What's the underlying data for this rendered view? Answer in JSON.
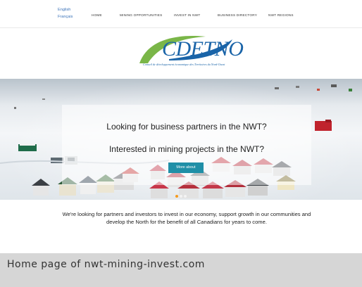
{
  "nav": {
    "languages": [
      "English",
      "Français"
    ],
    "menu": [
      "HOME",
      "MINING OPPORTUNITIES",
      "INVEST IN NWT",
      "BUSINESS DIRECTORY",
      "NWT REGIONS"
    ]
  },
  "logo": {
    "name": "CDETNO",
    "tagline": "Conseil de développement économique des Territoires du Nord-Ouest"
  },
  "hero": {
    "headline_1": "Looking for business partners in the NWT?",
    "headline_2": "Interested in mining projects in the NWT?",
    "button_label": "More about",
    "slide_count": 3,
    "active_slide": 1
  },
  "mission": {
    "text": "We're looking for partners and investors to invest in our economy, support growth in our communities and develop the North for the benefit of all Canadians for years to come."
  },
  "caption": {
    "text": "Home page of nwt-mining-invest.com"
  },
  "colors": {
    "brand_blue": "#1a64a8",
    "brand_green": "#7ab648",
    "button_teal": "#1f8fa7",
    "slider_active": "#f59b1e",
    "caption_bg": "#d6d6d6"
  }
}
